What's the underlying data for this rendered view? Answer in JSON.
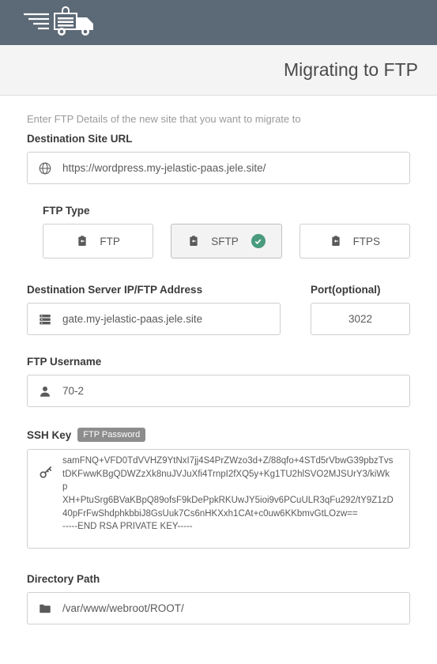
{
  "header": {
    "title": "Migrating to FTP"
  },
  "intro": "Enter FTP Details of the new site that you want to migrate to",
  "fields": {
    "url": {
      "label": "Destination Site URL",
      "value": "https://wordpress.my-jelastic-paas.jele.site/"
    },
    "ftpType": {
      "label": "FTP Type",
      "options": {
        "ftp": "FTP",
        "sftp": "SFTP",
        "ftps": "FTPS"
      },
      "selected": "sftp"
    },
    "server": {
      "label": "Destination Server IP/FTP Address",
      "value": "gate.my-jelastic-paas.jele.site"
    },
    "port": {
      "label": "Port(optional)",
      "value": "3022"
    },
    "username": {
      "label": "FTP Username",
      "value": "70-2"
    },
    "sshKey": {
      "label": "SSH Key",
      "badge": "FTP Password",
      "value": "samFNQ+VFD0TdVVHZ9YtNxI7jj4S4PrZWzo3d+Z/88qfo+4STd5rVbwG39pbzTvs\ntDKFwwKBgQDWZzXk8nuJVJuXfi4TrnpI2fXQ5y+Kg1TU2hlSVO2MJSUrY3/kiWkp\nXH+PtuSrg6BVaKBpQ89ofsF9kDePpkRKUwJY5ioi9v6PCuULR3qFu292/tY9Z1zD\n40pFrFwShdphkbbiJ8GsUuk7Cs6nHKXxh1CAt+c0uw6KKbmvGtLOzw==\n-----END RSA PRIVATE KEY-----"
    },
    "dirPath": {
      "label": "Directory Path",
      "value": "/var/www/webroot/ROOT/"
    }
  }
}
